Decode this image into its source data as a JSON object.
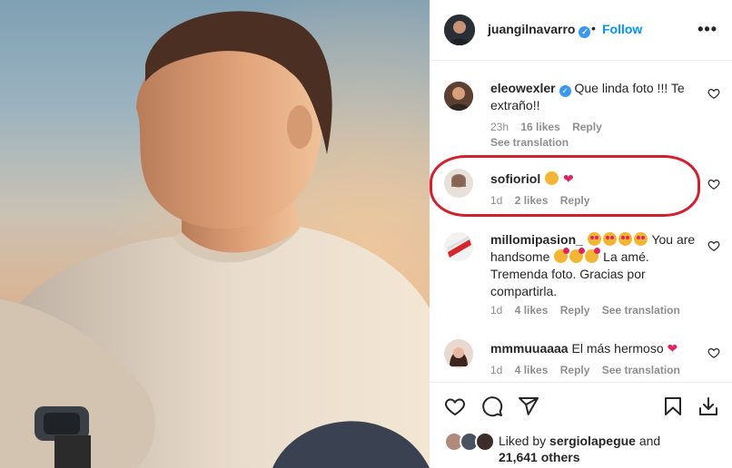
{
  "post": {
    "username": "juangilnavarro",
    "dot": "•",
    "follow_label": "Follow",
    "more_label": "•••",
    "verified_mark": "✓"
  },
  "comments": [
    {
      "username": "eleowexler",
      "text": "Que linda foto !!! Te extraño!!",
      "time": "23h",
      "likes": "16 likes",
      "reply": "Reply",
      "see_translation": "See translation"
    },
    {
      "username": "sofioriol",
      "time": "1d",
      "likes": "2 likes",
      "reply": "Reply"
    },
    {
      "username": "millomipasion_",
      "text_1": "You are",
      "text_2": "handsome",
      "text_3": "La amé.",
      "text_4": "Tremenda foto. Gracias por compartirla.",
      "time": "1d",
      "likes": "4 likes",
      "reply": "Reply",
      "see_translation": "See translation"
    },
    {
      "username": "mmmuuaaaa",
      "text": "El más hermoso",
      "time": "1d",
      "likes": "4 likes",
      "reply": "Reply",
      "see_translation": "See translation"
    }
  ],
  "liked_by": {
    "prefix": "Liked by",
    "user": "sergiolapegue",
    "and": "and",
    "others": "21,641 others"
  },
  "colors": {
    "accent": "#0095f6",
    "verified": "#3897f0",
    "highlight_circle": "#d0202e",
    "heart_red": "#e0245e"
  },
  "icons": [
    "heart-icon",
    "comment-icon",
    "share-icon",
    "bookmark-icon",
    "download-icon",
    "verified-icon",
    "more-icon"
  ]
}
